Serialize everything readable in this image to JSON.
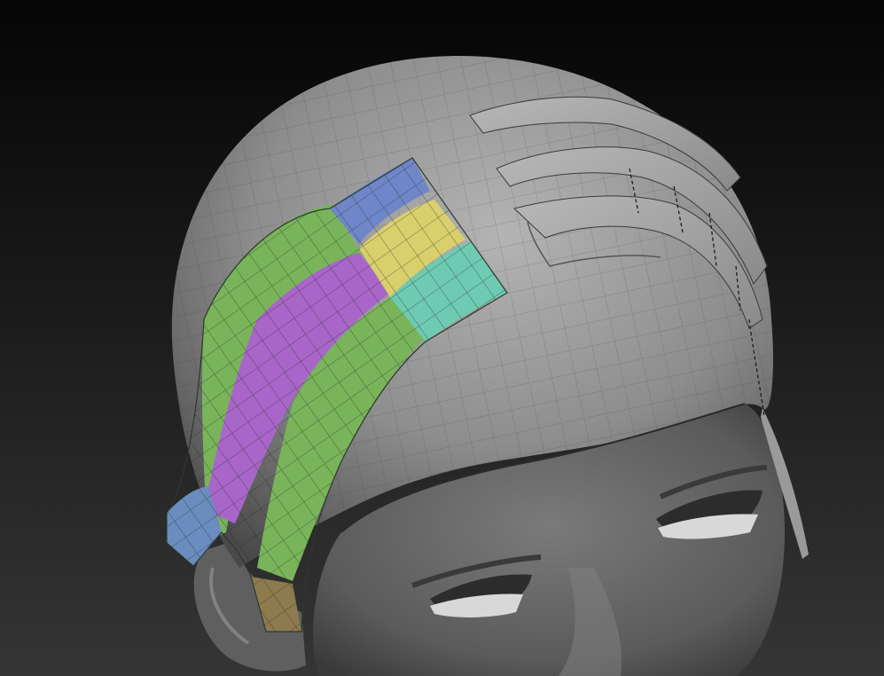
{
  "viewport": {
    "background_top": "#050505",
    "background_bottom": "#353535"
  },
  "model": {
    "subject": "sculpted-head",
    "base_color": "#8c8c8c",
    "wire_color": "#2a2a2a"
  },
  "polygroups": [
    {
      "name": "blue-cap",
      "color": "#6f86c9"
    },
    {
      "name": "yellow",
      "color": "#d9cf6c"
    },
    {
      "name": "teal",
      "color": "#6fcab2"
    },
    {
      "name": "green",
      "color": "#79b45a"
    },
    {
      "name": "purple",
      "color": "#a866c8"
    },
    {
      "name": "blue-tip",
      "color": "#6a8cbf"
    },
    {
      "name": "brown-tip",
      "color": "#8d7a4f"
    }
  ]
}
